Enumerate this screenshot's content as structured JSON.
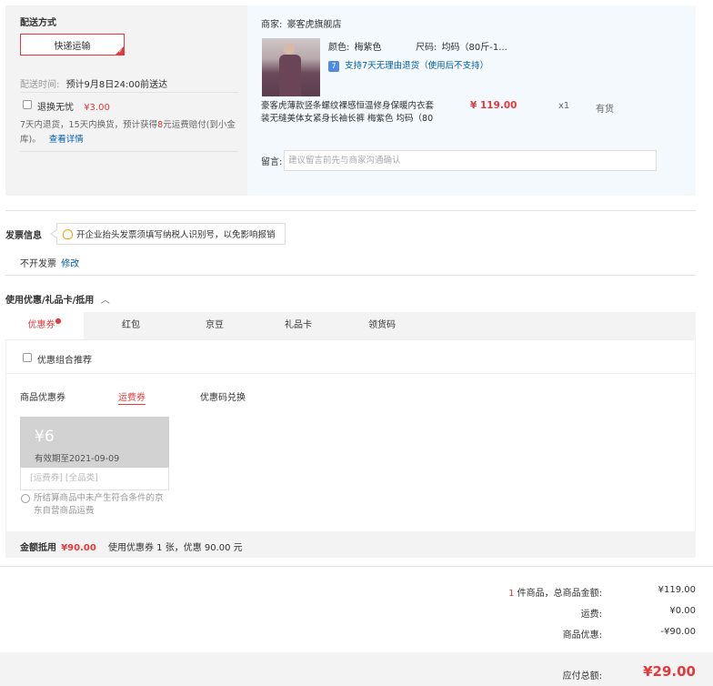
{
  "shipping": {
    "title": "配送方式",
    "method": "快递运输",
    "time_label": "配送时间:",
    "time_value": "预计9月8日24:00前送达",
    "return_label": "退换无忧",
    "return_price": "¥3.00",
    "return_desc_a": "7天内退货，15天内换货，预计获得",
    "return_desc_red": "8",
    "return_desc_b": "元运费赔付(到小金",
    "return_desc_c": "库)。",
    "detail_link": "查看详情"
  },
  "order": {
    "shop_label": "商家:",
    "shop_name": "豪客虎旗舰店",
    "color_label": "颜色:",
    "color_value": "梅紫色",
    "size_label": "尺码:",
    "size_value": "均码（80斤-1...",
    "return_badge": "7",
    "return_support": "支持7天无理由退货（使用后不支持）",
    "product_title_1": "豪客虎薄款竖条螺纹裸感恒温修身保暖内衣套",
    "product_title_2": "装无缝美体女紧身长袖长裤 梅紫色 均码（80",
    "price": "¥ 119.00",
    "qty": "x1",
    "stock": "有货",
    "note_label": "留言:",
    "note_placeholder": "建议留言前先与商家沟通确认"
  },
  "invoice": {
    "title": "发票信息",
    "tip": "开企业抬头发票须填写纳税人识别号，以免影响报销",
    "status": "不开发票",
    "modify": "修改"
  },
  "coupons": {
    "title": "使用优惠/礼品卡/抵用",
    "tabs": [
      "优惠券",
      "红包",
      "京豆",
      "礼品卡",
      "领货码"
    ],
    "combo_label": "优惠组合推荐",
    "subtabs": [
      "商品优惠券",
      "运费券",
      "优惠码兑换"
    ],
    "card_amount": "¥6",
    "card_expiry": "有效期至2021-09-09",
    "card_tags": "[运费券] [全品类]",
    "card_note_1": "所结算商品中未产生符合条件的京",
    "card_note_2": "东自营商品运费",
    "sum_label": "金额抵用",
    "sum_value": "¥90.00",
    "sum_desc": "使用优惠券 1 张，优惠 90.00 元"
  },
  "totals": {
    "count_red": "1",
    "count_text": "件商品，总商品金额:",
    "goods_amount": "¥119.00",
    "freight_label": "运费:",
    "freight_amount": "¥0.00",
    "discount_label": "商品优惠:",
    "discount_amount": "-¥90.00",
    "payable_label": "应付总额:",
    "payable_amount": "¥29.00"
  },
  "colors": {
    "accent": "#e4393c",
    "link": "#005ea7",
    "panel": "#f3f3f3",
    "panel_blue": "#f3f9fd"
  }
}
